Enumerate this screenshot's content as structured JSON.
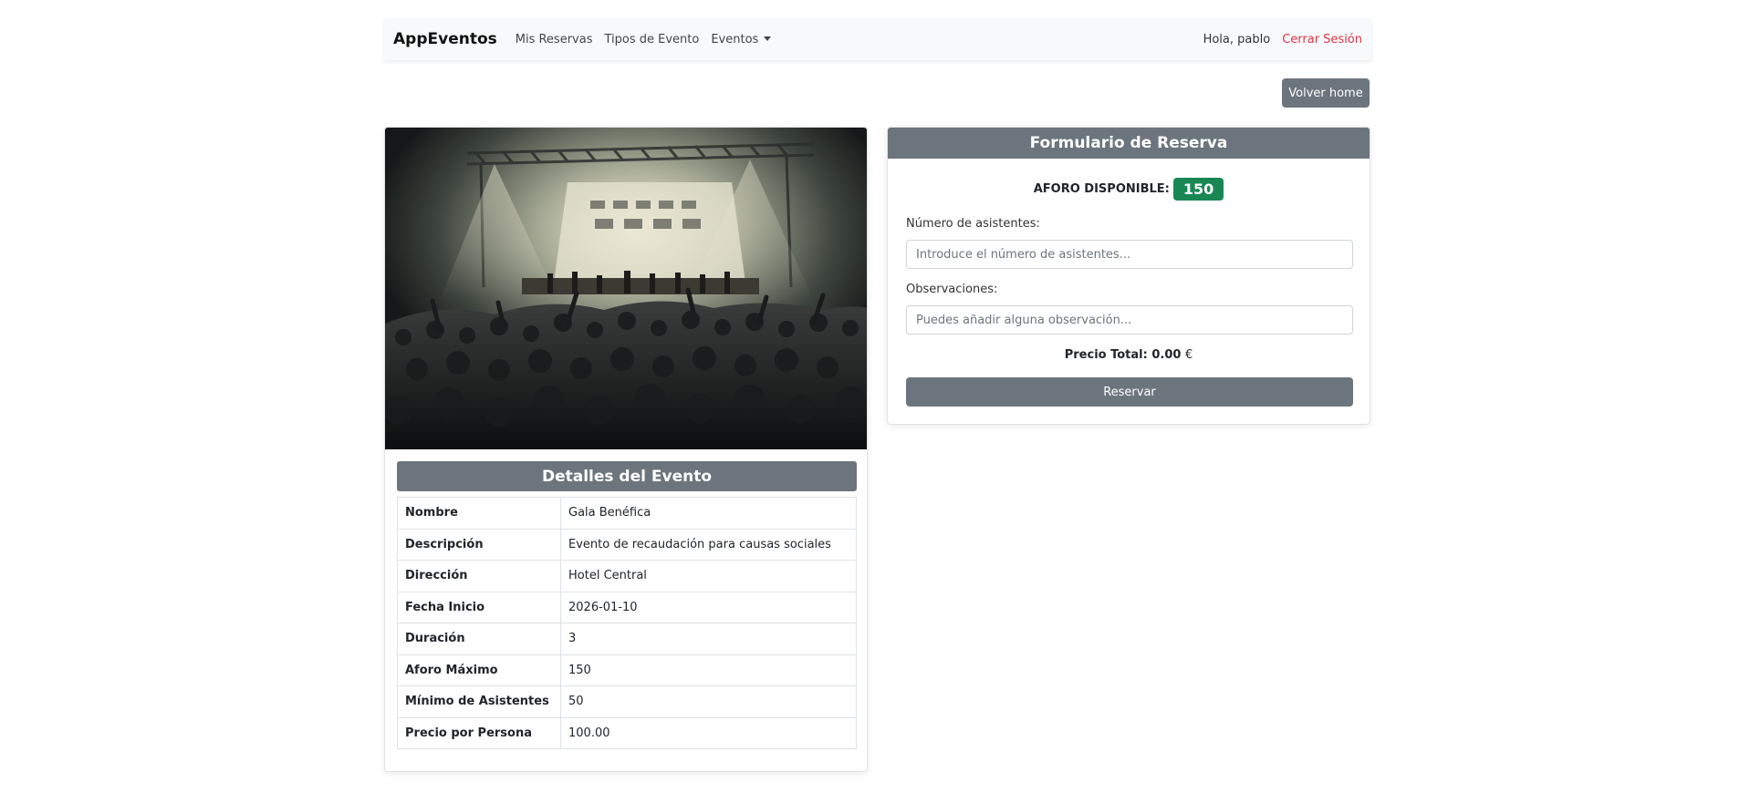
{
  "navbar": {
    "brand": "AppEventos",
    "links": [
      "Mis Reservas",
      "Tipos de Evento",
      "Eventos"
    ],
    "greeting": "Hola, pablo",
    "logout": "Cerrar Sesión"
  },
  "back_button": "Volver home",
  "details": {
    "title": "Detalles del Evento",
    "rows": [
      {
        "key": "Nombre",
        "value": "Gala Benéfica"
      },
      {
        "key": "Descripción",
        "value": "Evento de recaudación para causas sociales"
      },
      {
        "key": "Dirección",
        "value": "Hotel Central"
      },
      {
        "key": "Fecha Inicio",
        "value": "2026-01-10"
      },
      {
        "key": "Duración",
        "value": "3"
      },
      {
        "key": "Aforo Máximo",
        "value": "150"
      },
      {
        "key": "Mínimo de Asistentes",
        "value": "50"
      },
      {
        "key": "Precio por Persona",
        "value": "100.00"
      }
    ]
  },
  "form": {
    "title": "Formulario de Reserva",
    "aforo_label": "AFORO DISPONIBLE:",
    "aforo_value": "150",
    "asistentes_label": "Número de asistentes:",
    "asistentes_placeholder": "Introduce el número de asistentes...",
    "observaciones_label": "Observaciones:",
    "observaciones_placeholder": "Puedes añadir alguna observación...",
    "total_label": "Precio Total: 0.00",
    "total_currency": "€",
    "reserve_button": "Reservar"
  },
  "colors": {
    "secondary": "#6c757d",
    "success": "#198754",
    "danger": "#dc3545"
  }
}
